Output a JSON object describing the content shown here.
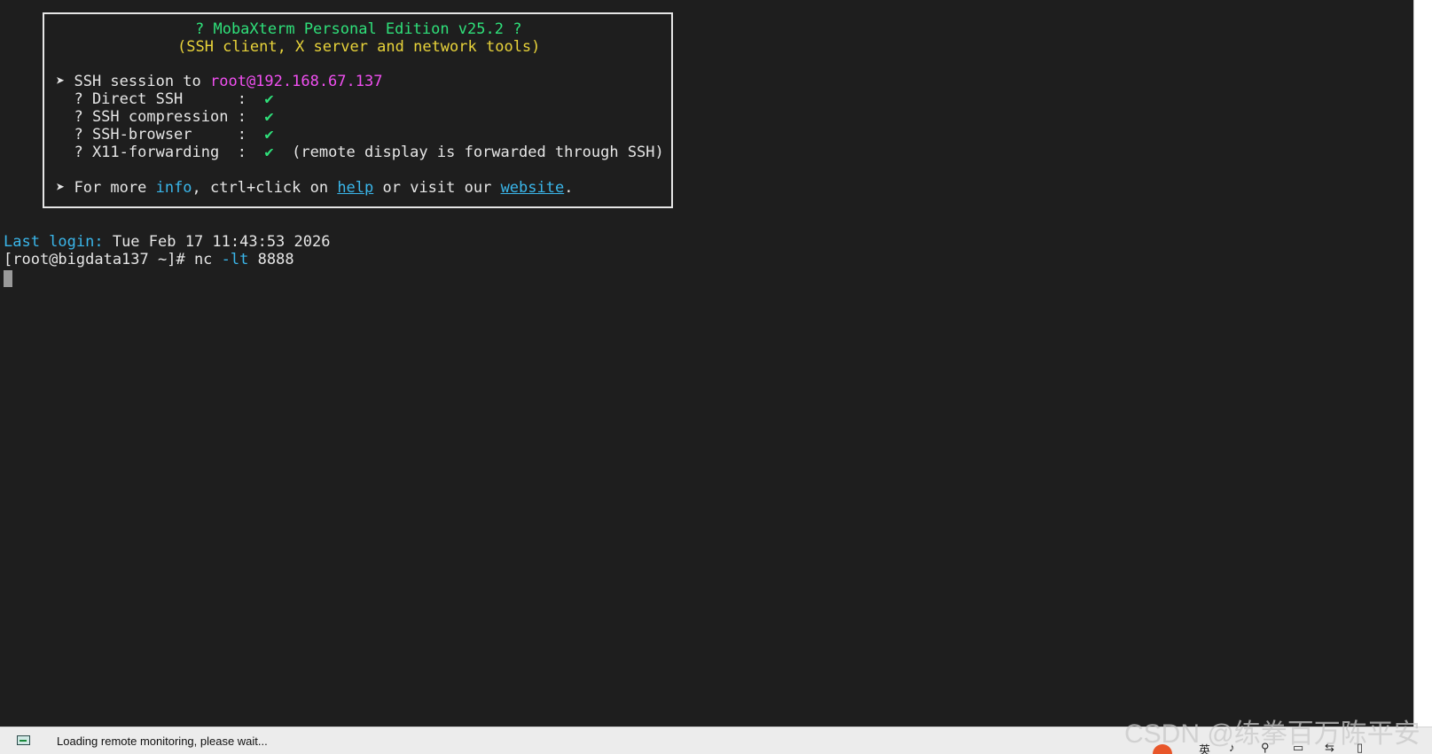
{
  "banner": {
    "title": "? MobaXterm Personal Edition v25.2 ?",
    "subtitle": "(SSH client, X server and network tools)",
    "session_prefix": "➤ SSH session to ",
    "session_target": "root@192.168.67.137",
    "features": [
      {
        "label": "  ? Direct SSH      :  ",
        "check": "✔",
        "note": ""
      },
      {
        "label": "  ? SSH compression :  ",
        "check": "✔",
        "note": ""
      },
      {
        "label": "  ? SSH-browser     :  ",
        "check": "✔",
        "note": ""
      },
      {
        "label": "  ? X11-forwarding  :  ",
        "check": "✔",
        "note": "  (remote display is forwarded through SSH)"
      }
    ],
    "info_prefix": "➤ For more ",
    "info_word": "info",
    "info_middle": ", ctrl+click on ",
    "help_link": "help",
    "info_middle2": " or visit our ",
    "website_link": "website",
    "info_suffix": "."
  },
  "terminal": {
    "last_login_label": "Last login:",
    "last_login_value": " Tue Feb 17 11:43:53 2026",
    "prompt": "[root@bigdata137 ~]# ",
    "command": "nc",
    "command_flag": " -lt",
    "command_arg": " 8888"
  },
  "statusbar": {
    "icon": "monitor-icon",
    "text": "Loading remote monitoring, please wait..."
  },
  "watermark": {
    "text": "CSDN @练拳百万陈平安"
  },
  "tray": {
    "ime": "英",
    "items": [
      "♪",
      "⚲",
      "▭",
      "⇆",
      "▯"
    ]
  },
  "colors": {
    "background": "#1e1e1e",
    "green": "#2fe07a",
    "yellow": "#e8d33a",
    "magenta": "#f04ff0",
    "cyan": "#3ab6ea",
    "text": "#e6e6e6"
  }
}
